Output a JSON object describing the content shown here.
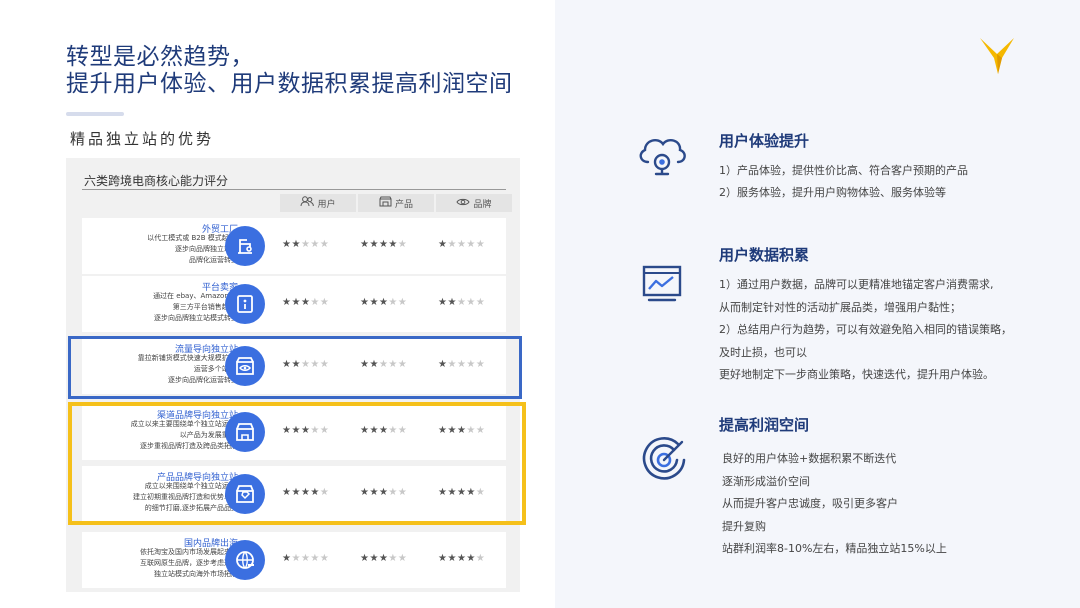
{
  "title": {
    "line1": "转型是必然趋势，",
    "line2": "提升用户体验、用户数据积累提高利润空间"
  },
  "subtitle": "精品独立站的优势",
  "panel": {
    "title": "六类跨境电商核心能力评分",
    "columns": [
      {
        "icon": "users-icon",
        "glyph": "ꟷ",
        "label": "用户"
      },
      {
        "icon": "store-icon",
        "glyph": "▭",
        "label": "产品"
      },
      {
        "icon": "eye-icon",
        "glyph": "◉",
        "label": "品牌"
      }
    ],
    "rows": [
      {
        "name": "外贸工厂",
        "desc": [
          "以代工模式或 B2B 模式起步,",
          "逐步向品牌独立站和",
          "品牌化运营转型"
        ],
        "icon": "sewing-machine-icon",
        "ratings": [
          2,
          4,
          1
        ]
      },
      {
        "name": "平台卖家",
        "desc": [
          "通过在 ebay、Amazon 等",
          "第三方平台销售起步,",
          "逐步向品牌独立站模式转型"
        ],
        "icon": "info-board-icon",
        "ratings": [
          3,
          3,
          2
        ]
      },
      {
        "name": "流量导向独立站",
        "desc": [
          "靠拉新铺货模式快速大规模扩张,",
          "运营多个站点,",
          "逐步向品牌化运营转型"
        ],
        "icon": "shop-eye-icon",
        "ratings": [
          2,
          2,
          1
        ]
      },
      {
        "name": "渠道品牌导向独立站",
        "desc": [
          "成立以来主要围绕单个独立站运营,",
          "以产品为发展重心,",
          "逐步重视品牌打造及跨品类拓展"
        ],
        "icon": "storefront-icon",
        "ratings": [
          3,
          3,
          3
        ]
      },
      {
        "name": "产品品牌导向独立站",
        "desc": [
          "成立以来围绕单个独立站运营,",
          "建立初期重视品牌打造和优势单品",
          "的细节打磨,逐步拓展产品品类"
        ],
        "icon": "shop-tag-icon",
        "ratings": [
          4,
          3,
          4
        ]
      },
      {
        "name": "国内品牌出海",
        "desc": [
          "依托淘宝及国内市场发展起来的",
          "互联网原生品牌，逐步考虑通过",
          "独立站模式向海外市场拓展"
        ],
        "icon": "globe-icon",
        "ratings": [
          1,
          3,
          4
        ]
      }
    ]
  },
  "sections": [
    {
      "icon": "cloud-webcam-icon",
      "heading": "用户体验提升",
      "lines": [
        "1）产品体验，提供性价比高、符合客户预期的产品",
        "2）服务体验，提升用户购物体验、服务体验等"
      ]
    },
    {
      "icon": "trend-chart-icon",
      "heading": "用户数据积累",
      "lines": [
        "1）通过用户数据，品牌可以更精准地锚定客户消费需求,",
        "从而制定针对性的活动扩展品类，增强用户黏性；",
        "2）总结用户行为趋势，可以有效避免陷入相同的错误策略，",
        "及时止损，也可以",
        "更好地制定下一步商业策略，快速迭代，提升用户体验。"
      ]
    },
    {
      "icon": "target-icon",
      "heading": "提高利润空间",
      "lines": [
        "良好的用户体验+数据积累不断迭代",
        "逐渐形成溢价空间",
        "从而提升客户忠诚度，吸引更多客户",
        "提升复购",
        "站群利润率8-10%左右，精品独立站15%以上"
      ]
    }
  ],
  "colors": {
    "title": "#1f3b7a",
    "accent_blue": "#3b6fe0",
    "highlight_blue": "#3a68c6",
    "highlight_yellow": "#f5c01a",
    "logo_yellow": "#f5b800"
  }
}
